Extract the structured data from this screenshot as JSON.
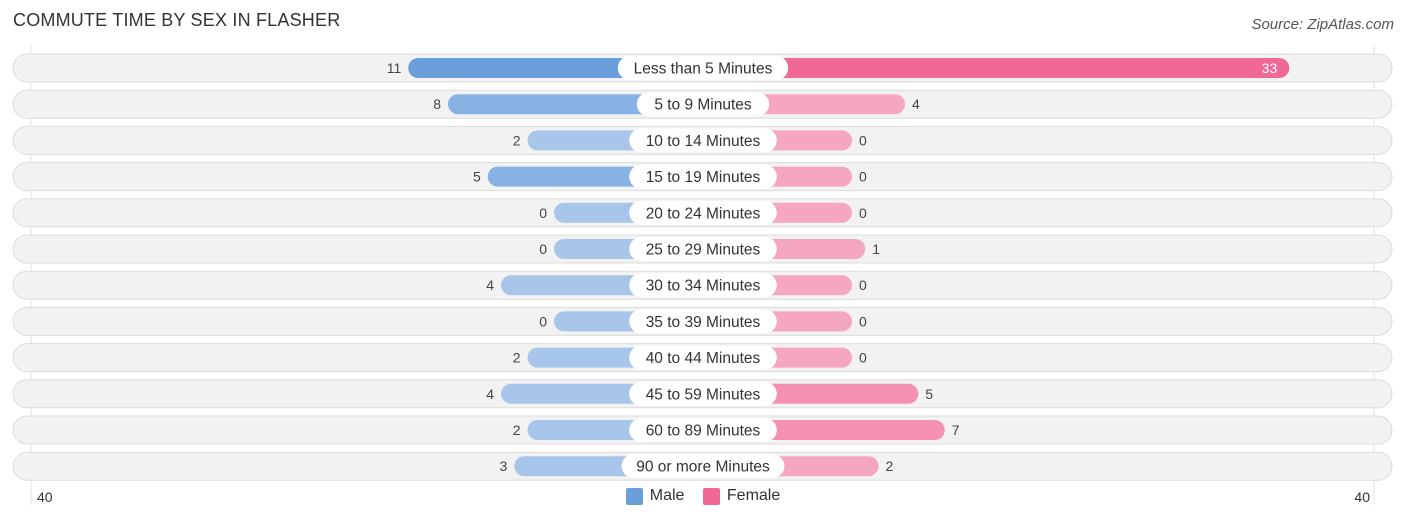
{
  "title": "COMMUTE TIME BY SEX IN FLASHER",
  "source": "Source: ZipAtlas.com",
  "colors": {
    "male": "#6a9fdc",
    "male_light": "#a7c6ea",
    "female": "#f06895",
    "female_light": "#f5a6c0",
    "track": "#f2f2f2",
    "track_border": "#dcdcdc"
  },
  "legend": {
    "male": "Male",
    "female": "Female"
  },
  "axis": {
    "left_label": "40",
    "right_label": "40"
  },
  "chart_data": {
    "type": "bar",
    "orientation": "horizontal-diverging",
    "title": "COMMUTE TIME BY SEX IN FLASHER",
    "categories": [
      "Less than 5 Minutes",
      "5 to 9 Minutes",
      "10 to 14 Minutes",
      "15 to 19 Minutes",
      "20 to 24 Minutes",
      "25 to 29 Minutes",
      "30 to 34 Minutes",
      "35 to 39 Minutes",
      "40 to 44 Minutes",
      "45 to 59 Minutes",
      "60 to 89 Minutes",
      "90 or more Minutes"
    ],
    "series": [
      {
        "name": "Male",
        "values": [
          11,
          8,
          2,
          5,
          0,
          0,
          4,
          0,
          2,
          4,
          2,
          3
        ]
      },
      {
        "name": "Female",
        "values": [
          33,
          4,
          0,
          0,
          0,
          1,
          0,
          0,
          0,
          5,
          7,
          2
        ]
      }
    ],
    "xlim": [
      -40,
      40
    ],
    "legend_position": "bottom-center"
  }
}
